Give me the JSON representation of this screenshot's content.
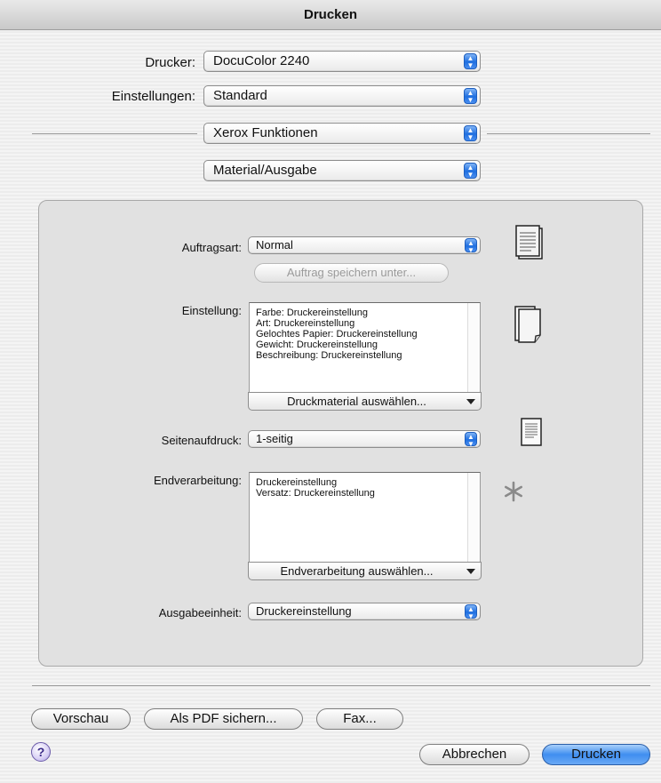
{
  "window": {
    "title": "Drucken"
  },
  "printer": {
    "label": "Drucker:",
    "value": "DocuColor 2240"
  },
  "presets": {
    "label": "Einstellungen:",
    "value": "Standard"
  },
  "feature_set": {
    "value": "Xerox Funktionen"
  },
  "panel_select": {
    "value": "Material/Ausgabe"
  },
  "job_type": {
    "label": "Auftragsart:",
    "value": "Normal",
    "save_button": "Auftrag speichern unter..."
  },
  "paper_settings": {
    "label": "Einstellung:",
    "lines": [
      "Farbe: Druckereinstellung",
      "Art: Druckereinstellung",
      "Gelochtes Papier: Druckereinstellung",
      "Gewicht: Druckereinstellung",
      "Beschreibung: Druckereinstellung"
    ],
    "select_button": "Druckmaterial auswählen..."
  },
  "sides": {
    "label": "Seitenaufdruck:",
    "value": "1-seitig"
  },
  "finishing": {
    "label": "Endverarbeitung:",
    "lines": [
      "Druckereinstellung",
      "Versatz: Druckereinstellung"
    ],
    "select_button": "Endverarbeitung auswählen..."
  },
  "output_device": {
    "label": "Ausgabeeinheit:",
    "value": "Druckereinstellung"
  },
  "footer": {
    "preview": "Vorschau",
    "save_pdf": "Als PDF sichern...",
    "fax": "Fax...",
    "help": "?",
    "cancel": "Abbrechen",
    "print": "Drucken"
  },
  "icons": {
    "job_icon": "document-stack-icon",
    "paper_icon": "paper-stack-icon",
    "sides_icon": "single-page-icon",
    "finishing_icon": "asterisk-icon"
  }
}
